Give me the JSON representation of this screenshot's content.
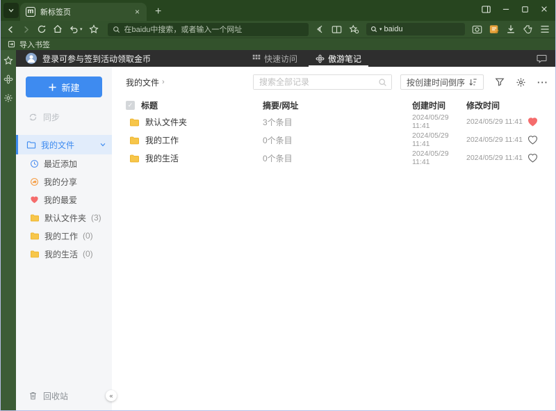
{
  "colors": {
    "accent": "#3e8bf0",
    "favorite": "#f56c6c",
    "folder": "#f7c64a"
  },
  "browser": {
    "tab_title": "新标签页",
    "new_tab_glyph": "+",
    "close_glyph": "×",
    "address_placeholder": "在baidu中搜索，或者输入一个网址",
    "quick_search_value": "baidu",
    "import_bookmarks": "导入书签"
  },
  "app_header": {
    "login_text": "登录可参与签到活动领取金币",
    "tabs": [
      {
        "label": "快速访问"
      },
      {
        "label": "傲游笔记"
      }
    ]
  },
  "sidebar": {
    "new_label": "新建",
    "sync_label": "同步",
    "my_files_label": "我的文件",
    "items": [
      {
        "label": "最近添加",
        "count": ""
      },
      {
        "label": "我的分享",
        "count": ""
      },
      {
        "label": "我的最爱",
        "count": ""
      },
      {
        "label": "默认文件夹",
        "count": "(3)"
      },
      {
        "label": "我的工作",
        "count": "(0)"
      },
      {
        "label": "我的生活",
        "count": "(0)"
      }
    ],
    "recycle_label": "回收站",
    "collapse_glyph": "«"
  },
  "content": {
    "breadcrumb": "我的文件",
    "breadcrumb_arrow": "›",
    "search_placeholder": "搜索全部记录",
    "sort_label": "按创建时间倒序",
    "columns": {
      "title": "标题",
      "summary": "摘要/网址",
      "created": "创建时间",
      "modified": "修改时间"
    },
    "rows": [
      {
        "title": "默认文件夹",
        "summary": "3个条目",
        "created": "2024/05/29 11:41",
        "modified": "2024/05/29 11:41",
        "favorite": true
      },
      {
        "title": "我的工作",
        "summary": "0个条目",
        "created": "2024/05/29 11:41",
        "modified": "2024/05/29 11:41",
        "favorite": false
      },
      {
        "title": "我的生活",
        "summary": "0个条目",
        "created": "2024/05/29 11:41",
        "modified": "2024/05/29 11:41",
        "favorite": false
      }
    ]
  }
}
